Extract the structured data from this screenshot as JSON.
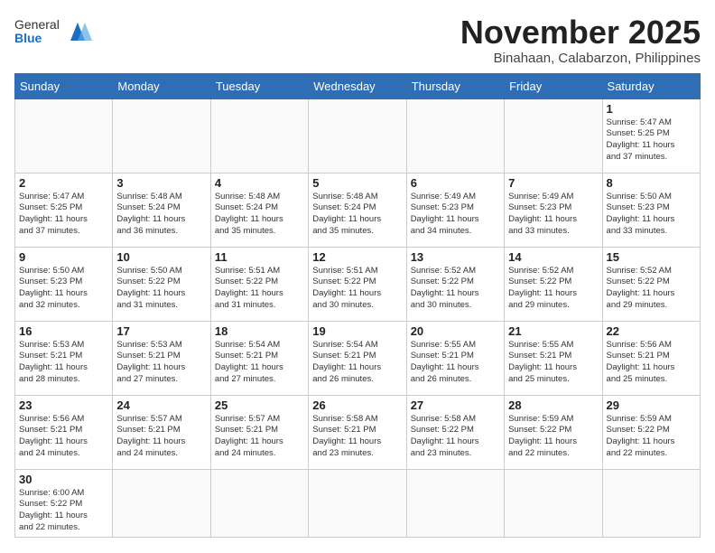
{
  "header": {
    "logo_general": "General",
    "logo_blue": "Blue",
    "month": "November 2025",
    "location": "Binahaan, Calabarzon, Philippines"
  },
  "weekdays": [
    "Sunday",
    "Monday",
    "Tuesday",
    "Wednesday",
    "Thursday",
    "Friday",
    "Saturday"
  ],
  "weeks": [
    [
      {
        "day": "",
        "info": ""
      },
      {
        "day": "",
        "info": ""
      },
      {
        "day": "",
        "info": ""
      },
      {
        "day": "",
        "info": ""
      },
      {
        "day": "",
        "info": ""
      },
      {
        "day": "",
        "info": ""
      },
      {
        "day": "1",
        "info": "Sunrise: 5:47 AM\nSunset: 5:25 PM\nDaylight: 11 hours\nand 37 minutes."
      }
    ],
    [
      {
        "day": "2",
        "info": "Sunrise: 5:47 AM\nSunset: 5:25 PM\nDaylight: 11 hours\nand 37 minutes."
      },
      {
        "day": "3",
        "info": "Sunrise: 5:48 AM\nSunset: 5:24 PM\nDaylight: 11 hours\nand 36 minutes."
      },
      {
        "day": "4",
        "info": "Sunrise: 5:48 AM\nSunset: 5:24 PM\nDaylight: 11 hours\nand 35 minutes."
      },
      {
        "day": "5",
        "info": "Sunrise: 5:48 AM\nSunset: 5:24 PM\nDaylight: 11 hours\nand 35 minutes."
      },
      {
        "day": "6",
        "info": "Sunrise: 5:49 AM\nSunset: 5:23 PM\nDaylight: 11 hours\nand 34 minutes."
      },
      {
        "day": "7",
        "info": "Sunrise: 5:49 AM\nSunset: 5:23 PM\nDaylight: 11 hours\nand 33 minutes."
      },
      {
        "day": "8",
        "info": "Sunrise: 5:50 AM\nSunset: 5:23 PM\nDaylight: 11 hours\nand 33 minutes."
      }
    ],
    [
      {
        "day": "9",
        "info": "Sunrise: 5:50 AM\nSunset: 5:23 PM\nDaylight: 11 hours\nand 32 minutes."
      },
      {
        "day": "10",
        "info": "Sunrise: 5:50 AM\nSunset: 5:22 PM\nDaylight: 11 hours\nand 31 minutes."
      },
      {
        "day": "11",
        "info": "Sunrise: 5:51 AM\nSunset: 5:22 PM\nDaylight: 11 hours\nand 31 minutes."
      },
      {
        "day": "12",
        "info": "Sunrise: 5:51 AM\nSunset: 5:22 PM\nDaylight: 11 hours\nand 30 minutes."
      },
      {
        "day": "13",
        "info": "Sunrise: 5:52 AM\nSunset: 5:22 PM\nDaylight: 11 hours\nand 30 minutes."
      },
      {
        "day": "14",
        "info": "Sunrise: 5:52 AM\nSunset: 5:22 PM\nDaylight: 11 hours\nand 29 minutes."
      },
      {
        "day": "15",
        "info": "Sunrise: 5:52 AM\nSunset: 5:22 PM\nDaylight: 11 hours\nand 29 minutes."
      }
    ],
    [
      {
        "day": "16",
        "info": "Sunrise: 5:53 AM\nSunset: 5:21 PM\nDaylight: 11 hours\nand 28 minutes."
      },
      {
        "day": "17",
        "info": "Sunrise: 5:53 AM\nSunset: 5:21 PM\nDaylight: 11 hours\nand 27 minutes."
      },
      {
        "day": "18",
        "info": "Sunrise: 5:54 AM\nSunset: 5:21 PM\nDaylight: 11 hours\nand 27 minutes."
      },
      {
        "day": "19",
        "info": "Sunrise: 5:54 AM\nSunset: 5:21 PM\nDaylight: 11 hours\nand 26 minutes."
      },
      {
        "day": "20",
        "info": "Sunrise: 5:55 AM\nSunset: 5:21 PM\nDaylight: 11 hours\nand 26 minutes."
      },
      {
        "day": "21",
        "info": "Sunrise: 5:55 AM\nSunset: 5:21 PM\nDaylight: 11 hours\nand 25 minutes."
      },
      {
        "day": "22",
        "info": "Sunrise: 5:56 AM\nSunset: 5:21 PM\nDaylight: 11 hours\nand 25 minutes."
      }
    ],
    [
      {
        "day": "23",
        "info": "Sunrise: 5:56 AM\nSunset: 5:21 PM\nDaylight: 11 hours\nand 24 minutes."
      },
      {
        "day": "24",
        "info": "Sunrise: 5:57 AM\nSunset: 5:21 PM\nDaylight: 11 hours\nand 24 minutes."
      },
      {
        "day": "25",
        "info": "Sunrise: 5:57 AM\nSunset: 5:21 PM\nDaylight: 11 hours\nand 24 minutes."
      },
      {
        "day": "26",
        "info": "Sunrise: 5:58 AM\nSunset: 5:21 PM\nDaylight: 11 hours\nand 23 minutes."
      },
      {
        "day": "27",
        "info": "Sunrise: 5:58 AM\nSunset: 5:22 PM\nDaylight: 11 hours\nand 23 minutes."
      },
      {
        "day": "28",
        "info": "Sunrise: 5:59 AM\nSunset: 5:22 PM\nDaylight: 11 hours\nand 22 minutes."
      },
      {
        "day": "29",
        "info": "Sunrise: 5:59 AM\nSunset: 5:22 PM\nDaylight: 11 hours\nand 22 minutes."
      }
    ],
    [
      {
        "day": "30",
        "info": "Sunrise: 6:00 AM\nSunset: 5:22 PM\nDaylight: 11 hours\nand 22 minutes."
      },
      {
        "day": "",
        "info": ""
      },
      {
        "day": "",
        "info": ""
      },
      {
        "day": "",
        "info": ""
      },
      {
        "day": "",
        "info": ""
      },
      {
        "day": "",
        "info": ""
      },
      {
        "day": "",
        "info": ""
      }
    ]
  ]
}
